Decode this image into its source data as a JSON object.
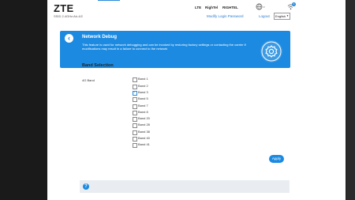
{
  "header": {
    "logo": "ZTE",
    "ssid": "SSID 2.4GHz:Air-4/2",
    "network_type": "LTE",
    "signal": "RighTel",
    "operator": "RIGHTEL",
    "notification_count": "0",
    "modify_password_link": "Modify Login Password",
    "logout_link": "Logout",
    "language_selected": "English"
  },
  "banner": {
    "title": "Network Debug",
    "description": "This feature is used for network debugging and can be invoked by restoring factory settings or contacting the carrier if modifications may result in a failure to connect to the network",
    "icon": "gear-icon"
  },
  "band_section": {
    "title": "Band Selection",
    "row_label": "4G Band",
    "bands": [
      {
        "label": "Band 1",
        "checked": false
      },
      {
        "label": "Band 2",
        "checked": false
      },
      {
        "label": "Band 3",
        "checked": true
      },
      {
        "label": "Band 5",
        "checked": false
      },
      {
        "label": "Band 7",
        "checked": false
      },
      {
        "label": "Band 8",
        "checked": false
      },
      {
        "label": "Band 20",
        "checked": false
      },
      {
        "label": "Band 28",
        "checked": false
      },
      {
        "label": "Band 38",
        "checked": false
      },
      {
        "label": "Band 40",
        "checked": false
      },
      {
        "label": "Band 41",
        "checked": false
      }
    ]
  },
  "actions": {
    "apply_label": "Apply"
  },
  "colors": {
    "accent": "#1c8ae0",
    "link": "#2a7dd1",
    "help_bg": "#e9edf1"
  }
}
